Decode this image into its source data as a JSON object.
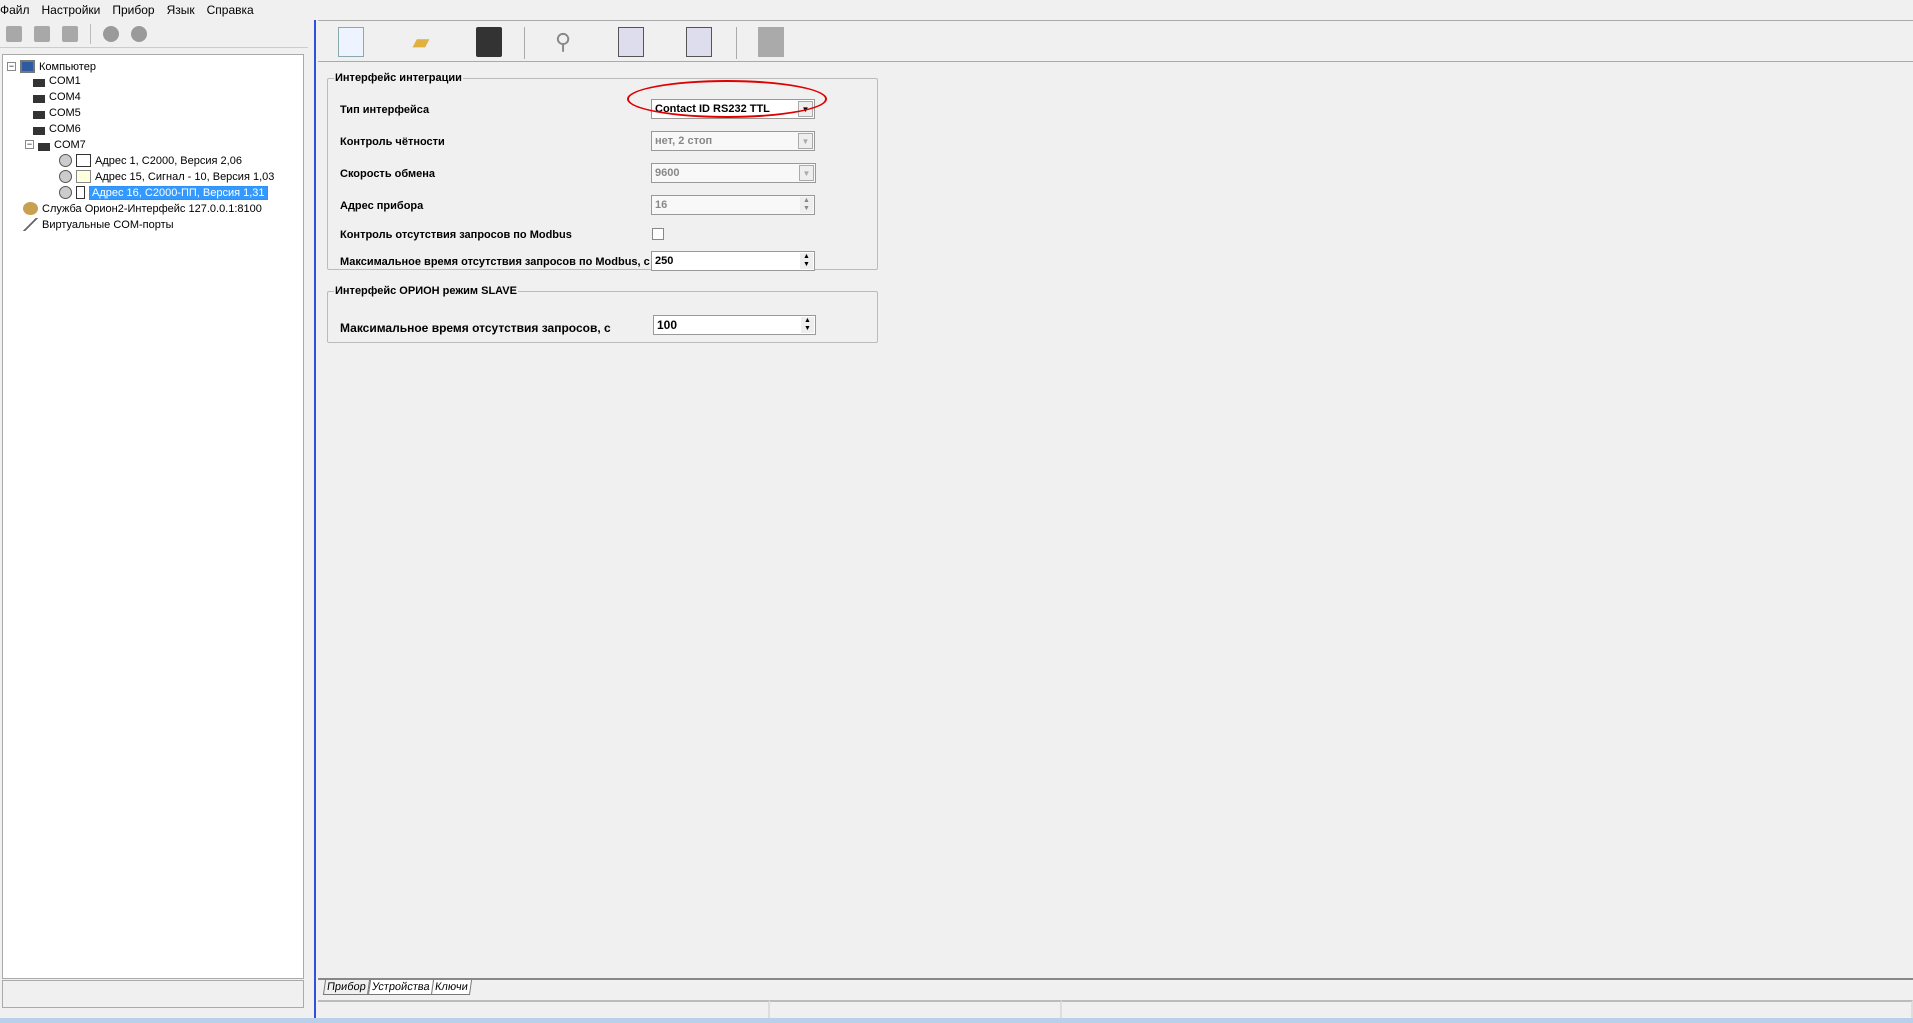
{
  "menu": [
    "Файл",
    "Настройки",
    "Прибор",
    "Язык",
    "Справка"
  ],
  "tree": {
    "root": "Компьютер",
    "ports": [
      "COM1",
      "COM4",
      "COM5",
      "COM6",
      "COM7"
    ],
    "devices": [
      "Адрес 1, С2000, Версия 2,06",
      "Адрес 15, Сигнал - 10, Версия 1,03",
      "Адрес 16, С2000-ПП, Версия 1,31"
    ],
    "selected": "Адрес 16, С2000-ПП, Версия 1,31",
    "service": "Служба Орион2-Интерфейс 127.0.0.1:8100",
    "virtual": "Виртуальные COM-порты"
  },
  "toolbar_icons": [
    "new-file-icon",
    "open-folder-icon",
    "save-icon",
    "search-icon",
    "read-config-icon",
    "write-config-icon",
    "firmware-icon"
  ],
  "group1": {
    "title": "Интерфейс интеграции",
    "interface_type": {
      "label": "Тип интерфейса",
      "value": "Contact ID RS232 TTL"
    },
    "parity": {
      "label": "Контроль чётности",
      "value": "нет, 2 стоп"
    },
    "baud": {
      "label": "Скорость обмена",
      "value": "9600"
    },
    "address": {
      "label": "Адрес прибора",
      "value": "16"
    },
    "modbus_check": {
      "label": "Контроль отсутствия запросов по Modbus",
      "checked": false
    },
    "modbus_timeout": {
      "label": "Максимальное время отсутствия запросов по Modbus, с",
      "value": "250"
    }
  },
  "group2": {
    "title": "Интерфейс ОРИОН режим SLAVE",
    "timeout": {
      "label": "Максимальное время отсутствия запросов, с",
      "value": "100"
    }
  },
  "tabs": [
    "Прибор",
    "Устройства",
    "Ключи"
  ],
  "highlight_color": "#e00000"
}
